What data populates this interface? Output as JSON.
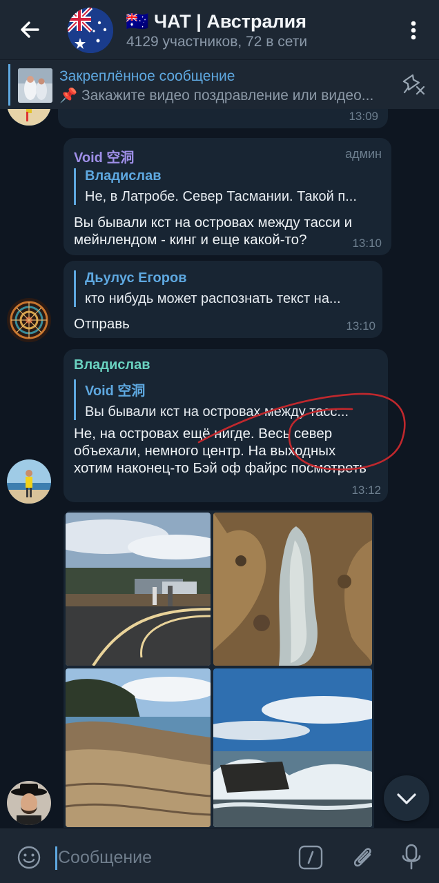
{
  "header": {
    "flag": "🇦🇺",
    "title": "ЧАТ | Австралия",
    "subtitle": "4129 участников, 72 в сети"
  },
  "pinned": {
    "title": "Закреплённое сообщение",
    "text": "📌 Закажите видео поздравление или видео..."
  },
  "messages": [
    {
      "time": "13:09"
    },
    {
      "sender": "Void 空洞",
      "sender_color": "#9f8fe8",
      "badge": "админ",
      "reply_name": "Владислав",
      "reply_text": "Не, в Латробе. Север Тасмании. Такой п...",
      "text": "Вы бывали кст на островах между тасси и мейнлендом - кинг и еще какой-то?",
      "time": "13:10"
    },
    {
      "reply_name": "Дьулус Егоров",
      "reply_text": "кто нибудь может распознать текст на...",
      "text": "Отправь",
      "time": "13:10"
    },
    {
      "sender": "Владислав",
      "sender_color": "#6ad2c0",
      "reply_name": "Void 空洞",
      "reply_text": "Вы бывали кст на островах между тасс...",
      "text": "Не, на островах ещё нигде. Весь север объехали, немного центр. На выходных хотим наконец-то Бэй оф файрс посмотреть",
      "time": "13:12"
    }
  ],
  "input": {
    "placeholder": "Сообщение"
  },
  "colors": {
    "background": "#0e1621",
    "header": "#1d2733",
    "bubble": "#182533",
    "accent": "#5ea8e0",
    "annotation": "#c0282d"
  },
  "icons": [
    "back-arrow-icon",
    "more-vert-icon",
    "unpin-icon",
    "emoji-icon",
    "bot-command-icon",
    "attach-icon",
    "mic-icon",
    "chevron-down-icon"
  ]
}
